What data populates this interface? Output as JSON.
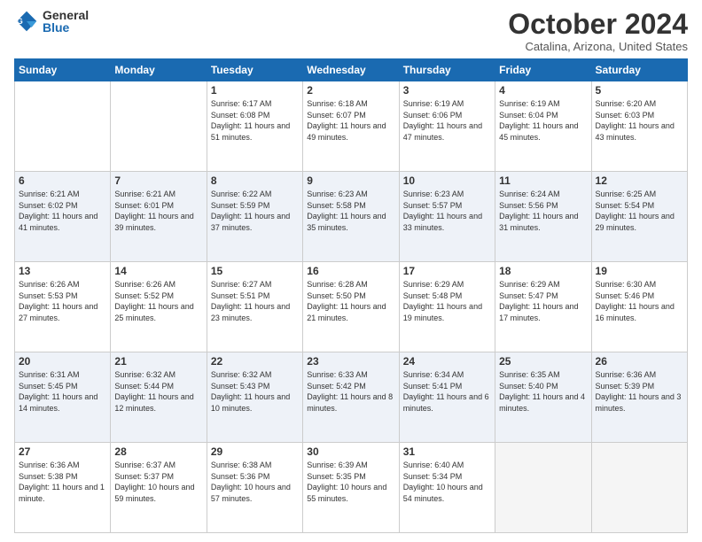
{
  "header": {
    "logo_general": "General",
    "logo_blue": "Blue",
    "month_title": "October 2024",
    "location": "Catalina, Arizona, United States"
  },
  "days_of_week": [
    "Sunday",
    "Monday",
    "Tuesday",
    "Wednesday",
    "Thursday",
    "Friday",
    "Saturday"
  ],
  "weeks": [
    [
      {
        "day": "",
        "empty": true
      },
      {
        "day": "",
        "empty": true
      },
      {
        "day": "1",
        "sunrise": "Sunrise: 6:17 AM",
        "sunset": "Sunset: 6:08 PM",
        "daylight": "Daylight: 11 hours and 51 minutes."
      },
      {
        "day": "2",
        "sunrise": "Sunrise: 6:18 AM",
        "sunset": "Sunset: 6:07 PM",
        "daylight": "Daylight: 11 hours and 49 minutes."
      },
      {
        "day": "3",
        "sunrise": "Sunrise: 6:19 AM",
        "sunset": "Sunset: 6:06 PM",
        "daylight": "Daylight: 11 hours and 47 minutes."
      },
      {
        "day": "4",
        "sunrise": "Sunrise: 6:19 AM",
        "sunset": "Sunset: 6:04 PM",
        "daylight": "Daylight: 11 hours and 45 minutes."
      },
      {
        "day": "5",
        "sunrise": "Sunrise: 6:20 AM",
        "sunset": "Sunset: 6:03 PM",
        "daylight": "Daylight: 11 hours and 43 minutes."
      }
    ],
    [
      {
        "day": "6",
        "sunrise": "Sunrise: 6:21 AM",
        "sunset": "Sunset: 6:02 PM",
        "daylight": "Daylight: 11 hours and 41 minutes."
      },
      {
        "day": "7",
        "sunrise": "Sunrise: 6:21 AM",
        "sunset": "Sunset: 6:01 PM",
        "daylight": "Daylight: 11 hours and 39 minutes."
      },
      {
        "day": "8",
        "sunrise": "Sunrise: 6:22 AM",
        "sunset": "Sunset: 5:59 PM",
        "daylight": "Daylight: 11 hours and 37 minutes."
      },
      {
        "day": "9",
        "sunrise": "Sunrise: 6:23 AM",
        "sunset": "Sunset: 5:58 PM",
        "daylight": "Daylight: 11 hours and 35 minutes."
      },
      {
        "day": "10",
        "sunrise": "Sunrise: 6:23 AM",
        "sunset": "Sunset: 5:57 PM",
        "daylight": "Daylight: 11 hours and 33 minutes."
      },
      {
        "day": "11",
        "sunrise": "Sunrise: 6:24 AM",
        "sunset": "Sunset: 5:56 PM",
        "daylight": "Daylight: 11 hours and 31 minutes."
      },
      {
        "day": "12",
        "sunrise": "Sunrise: 6:25 AM",
        "sunset": "Sunset: 5:54 PM",
        "daylight": "Daylight: 11 hours and 29 minutes."
      }
    ],
    [
      {
        "day": "13",
        "sunrise": "Sunrise: 6:26 AM",
        "sunset": "Sunset: 5:53 PM",
        "daylight": "Daylight: 11 hours and 27 minutes."
      },
      {
        "day": "14",
        "sunrise": "Sunrise: 6:26 AM",
        "sunset": "Sunset: 5:52 PM",
        "daylight": "Daylight: 11 hours and 25 minutes."
      },
      {
        "day": "15",
        "sunrise": "Sunrise: 6:27 AM",
        "sunset": "Sunset: 5:51 PM",
        "daylight": "Daylight: 11 hours and 23 minutes."
      },
      {
        "day": "16",
        "sunrise": "Sunrise: 6:28 AM",
        "sunset": "Sunset: 5:50 PM",
        "daylight": "Daylight: 11 hours and 21 minutes."
      },
      {
        "day": "17",
        "sunrise": "Sunrise: 6:29 AM",
        "sunset": "Sunset: 5:48 PM",
        "daylight": "Daylight: 11 hours and 19 minutes."
      },
      {
        "day": "18",
        "sunrise": "Sunrise: 6:29 AM",
        "sunset": "Sunset: 5:47 PM",
        "daylight": "Daylight: 11 hours and 17 minutes."
      },
      {
        "day": "19",
        "sunrise": "Sunrise: 6:30 AM",
        "sunset": "Sunset: 5:46 PM",
        "daylight": "Daylight: 11 hours and 16 minutes."
      }
    ],
    [
      {
        "day": "20",
        "sunrise": "Sunrise: 6:31 AM",
        "sunset": "Sunset: 5:45 PM",
        "daylight": "Daylight: 11 hours and 14 minutes."
      },
      {
        "day": "21",
        "sunrise": "Sunrise: 6:32 AM",
        "sunset": "Sunset: 5:44 PM",
        "daylight": "Daylight: 11 hours and 12 minutes."
      },
      {
        "day": "22",
        "sunrise": "Sunrise: 6:32 AM",
        "sunset": "Sunset: 5:43 PM",
        "daylight": "Daylight: 11 hours and 10 minutes."
      },
      {
        "day": "23",
        "sunrise": "Sunrise: 6:33 AM",
        "sunset": "Sunset: 5:42 PM",
        "daylight": "Daylight: 11 hours and 8 minutes."
      },
      {
        "day": "24",
        "sunrise": "Sunrise: 6:34 AM",
        "sunset": "Sunset: 5:41 PM",
        "daylight": "Daylight: 11 hours and 6 minutes."
      },
      {
        "day": "25",
        "sunrise": "Sunrise: 6:35 AM",
        "sunset": "Sunset: 5:40 PM",
        "daylight": "Daylight: 11 hours and 4 minutes."
      },
      {
        "day": "26",
        "sunrise": "Sunrise: 6:36 AM",
        "sunset": "Sunset: 5:39 PM",
        "daylight": "Daylight: 11 hours and 3 minutes."
      }
    ],
    [
      {
        "day": "27",
        "sunrise": "Sunrise: 6:36 AM",
        "sunset": "Sunset: 5:38 PM",
        "daylight": "Daylight: 11 hours and 1 minute."
      },
      {
        "day": "28",
        "sunrise": "Sunrise: 6:37 AM",
        "sunset": "Sunset: 5:37 PM",
        "daylight": "Daylight: 10 hours and 59 minutes."
      },
      {
        "day": "29",
        "sunrise": "Sunrise: 6:38 AM",
        "sunset": "Sunset: 5:36 PM",
        "daylight": "Daylight: 10 hours and 57 minutes."
      },
      {
        "day": "30",
        "sunrise": "Sunrise: 6:39 AM",
        "sunset": "Sunset: 5:35 PM",
        "daylight": "Daylight: 10 hours and 55 minutes."
      },
      {
        "day": "31",
        "sunrise": "Sunrise: 6:40 AM",
        "sunset": "Sunset: 5:34 PM",
        "daylight": "Daylight: 10 hours and 54 minutes."
      },
      {
        "day": "",
        "empty": true
      },
      {
        "day": "",
        "empty": true
      }
    ]
  ]
}
